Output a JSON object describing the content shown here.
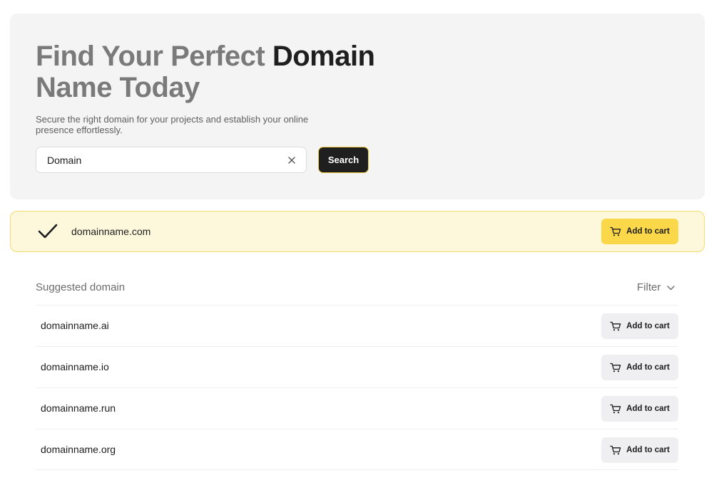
{
  "hero": {
    "title_light": "Find Your Perfect ",
    "title_dark": "Domain",
    "title_line2": "Name Today",
    "subtitle": "Secure the right domain for your projects and establish your online presence effortlessly.",
    "search": {
      "value": "Domain",
      "placeholder": "Domain"
    },
    "search_label": "Search",
    "clear_icon": "close-icon"
  },
  "result": {
    "status_icon": "checkmark-icon",
    "domain": "domainname.com",
    "cart_label": "Add to cart"
  },
  "suggestions": {
    "title": "Suggested domain",
    "filter_label": "Filter",
    "items": [
      {
        "domain": "domainname.ai",
        "cart_label": "Add to cart"
      },
      {
        "domain": "domainname.io",
        "cart_label": "Add to cart"
      },
      {
        "domain": "domainname.run",
        "cart_label": "Add to cart"
      },
      {
        "domain": "domainname.org",
        "cart_label": "Add to cart"
      }
    ]
  },
  "colors": {
    "accent": "#fbd84a",
    "result_bg": "#fdf8dc",
    "dark_button": "#1f1f1f",
    "hero_bg": "#f4f4f4"
  }
}
